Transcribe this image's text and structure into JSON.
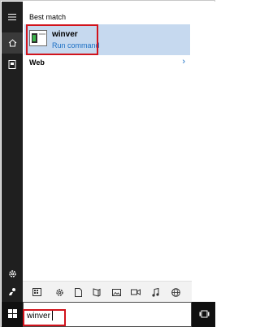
{
  "left_rail": {
    "icons": [
      "hamburger-menu-icon",
      "home-icon",
      "notebook-icon",
      "settings-icon",
      "feedback-icon"
    ]
  },
  "results": {
    "best_match_label": "Best match",
    "best_match": {
      "icon": "run-command-app-icon",
      "name": "winver",
      "type": "Run command"
    },
    "web_label": "Web",
    "web_chevron": "›"
  },
  "filters": {
    "icons": [
      "apps-filter-icon",
      "settings-filter-icon",
      "documents-filter-icon",
      "folders-filter-icon",
      "photos-filter-icon",
      "videos-filter-icon",
      "music-filter-icon",
      "web-filter-icon"
    ]
  },
  "taskbar": {
    "search_value": "winver",
    "start_icon": "windows-logo-icon",
    "taskview_icon": "task-view-icon"
  },
  "colors": {
    "rail_bg": "#1f1f1f",
    "tile_highlight": "#c6d9ef",
    "accent_blue": "#1a6fc4",
    "annotation_red": "#d1131c"
  }
}
